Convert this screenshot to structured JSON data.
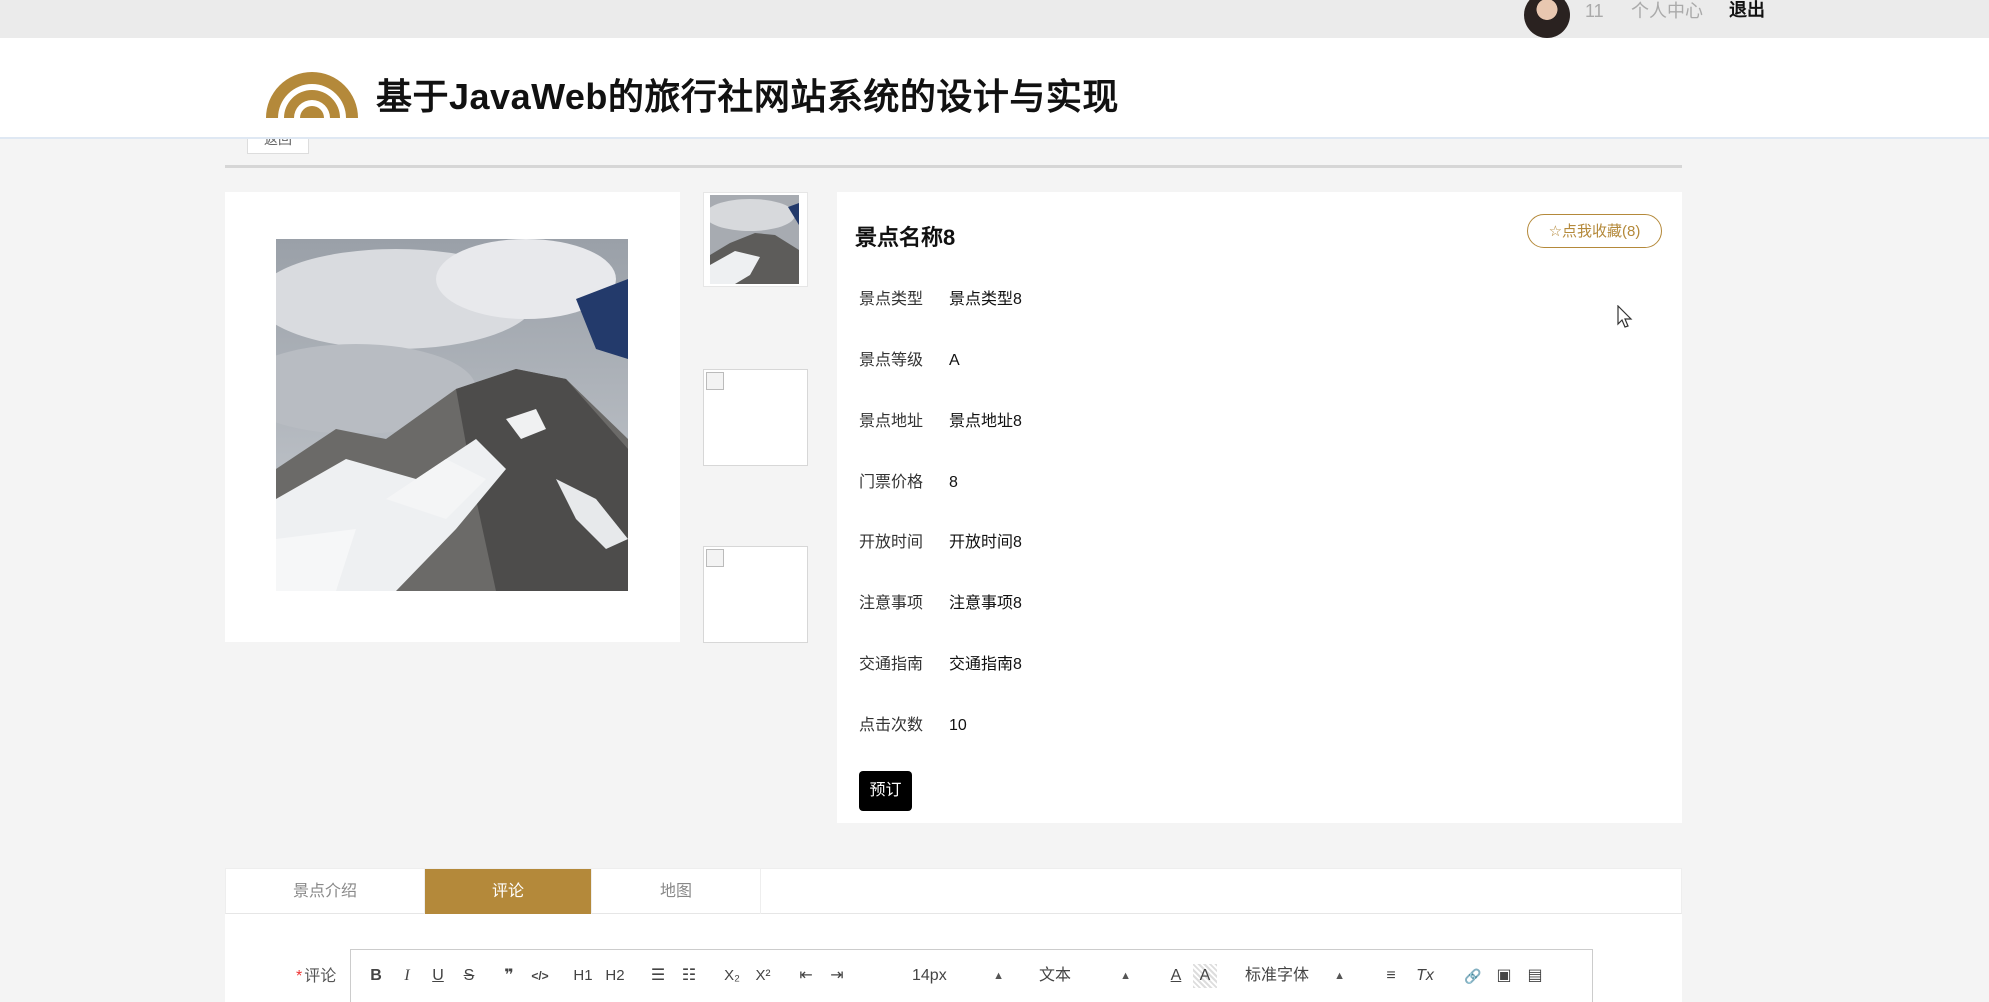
{
  "topbar": {
    "user_id": "11",
    "user_center": "个人中心",
    "logout": "退出"
  },
  "header": {
    "title": "基于JavaWeb的旅行社网站系统的设计与实现",
    "back": "返回"
  },
  "colors": {
    "accent": "#b4893a",
    "book_button": "#000000"
  },
  "attraction": {
    "name": "景点名称8",
    "favorite": "☆点我收藏(8)",
    "fields": [
      {
        "label": "景点类型",
        "value": "景点类型8"
      },
      {
        "label": "景点等级",
        "value": "A"
      },
      {
        "label": "景点地址",
        "value": "景点地址8"
      },
      {
        "label": "门票价格",
        "value": "8"
      },
      {
        "label": "开放时间",
        "value": "开放时间8"
      },
      {
        "label": "注意事项",
        "value": "注意事项8"
      },
      {
        "label": "交通指南",
        "value": "交通指南8"
      },
      {
        "label": "点击次数",
        "value": "10"
      }
    ],
    "book": "预订"
  },
  "tabs": [
    {
      "label": "景点介绍",
      "active": false
    },
    {
      "label": "评论",
      "active": true
    },
    {
      "label": "地图",
      "active": false
    }
  ],
  "comment": {
    "required_mark": "*",
    "label": "评论",
    "toolbar": {
      "bold": "B",
      "italic": "I",
      "underline": "U",
      "strike": "S",
      "blockquote": "❞",
      "code": "</>",
      "h1": "H1",
      "h2": "H2",
      "ordered_list": "☰",
      "bullet_list": "☷",
      "subscript": "X₂",
      "superscript": "X²",
      "outdent": "⇤",
      "indent": "⇥",
      "size": "14px",
      "text_type": "文本",
      "font_color": "A",
      "background": "A",
      "font_family": "标准字体",
      "align": "≡",
      "clear": "Tx",
      "link": "🔗",
      "image": "▣",
      "video": "▤"
    }
  }
}
